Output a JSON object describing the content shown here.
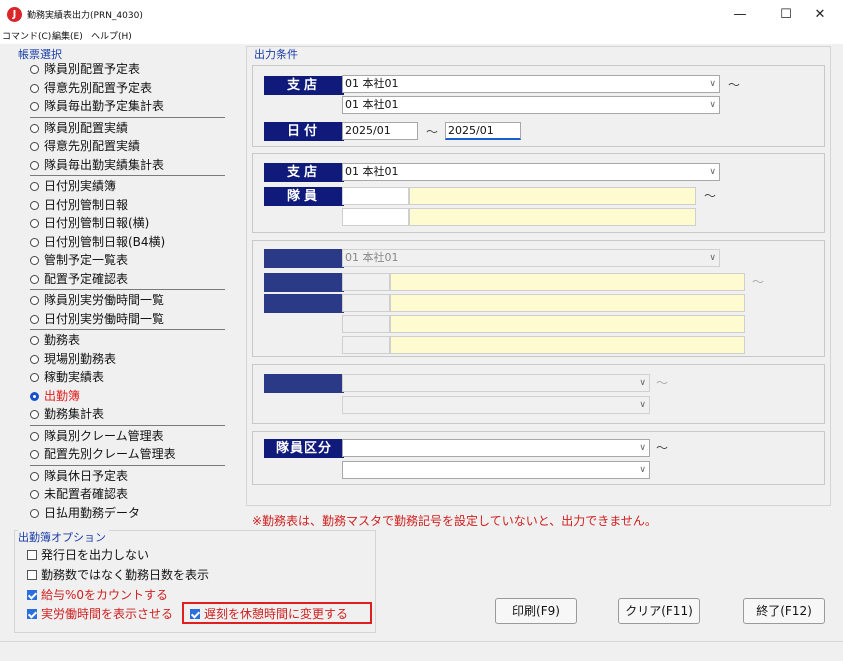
{
  "window": {
    "title": "勤務実績表出力(PRN_4030)",
    "icon_letter": "J",
    "minimize": "—",
    "maximize": "☐",
    "close": "✕"
  },
  "menu": [
    "コマンド(C)",
    "編集(E)",
    "ヘルプ(H)"
  ],
  "report_select": {
    "label": "帳票選択",
    "groups": [
      [
        "隊員別配置予定表",
        "得意先別配置予定表",
        "隊員毎出勤予定集計表"
      ],
      [
        "隊員別配置実績",
        "得意先別配置実績",
        "隊員毎出勤実績集計表"
      ],
      [
        "日付別実績簿",
        "日付別管制日報",
        "日付別管制日報(横)",
        "日付別管制日報(B4横)",
        "管制予定一覧表",
        "配置予定確認表"
      ],
      [
        "隊員別実労働時間一覧",
        "日付別実労働時間一覧"
      ],
      [
        "勤務表",
        "現場別勤務表",
        "稼動実績表",
        "出勤簿",
        "勤務集計表"
      ],
      [
        "隊員別クレーム管理表",
        "配置先別クレーム管理表"
      ],
      [
        "隊員休日予定表",
        "未配置者確認表",
        "日払用勤務データ"
      ]
    ],
    "selected": "出勤簿"
  },
  "conditions": {
    "label": "出力条件",
    "branch_range": {
      "label": "支店",
      "from": "01 本社01",
      "to": "01 本社01",
      "tilde": "～"
    },
    "date_range": {
      "label": "日付",
      "from": "2025/01",
      "to": "2025/01",
      "tilde": "～"
    },
    "branch2": {
      "label": "支店",
      "value": "01 本社01"
    },
    "member": {
      "label": "隊員",
      "tilde": "～"
    },
    "branch3": {
      "label": "支店",
      "value": "01 本社01"
    },
    "tilde3": "～",
    "tilde4": "～",
    "member_class": {
      "label": "隊員区分",
      "tilde": "～"
    },
    "note": "※勤務表は、勤務マスタで勤務記号を設定していないと、出力できません。"
  },
  "options": {
    "label": "出勤簿オプション",
    "items": [
      {
        "label": "発行日を出力しない",
        "checked": false
      },
      {
        "label": "勤務数ではなく勤務日数を表示",
        "checked": false
      },
      {
        "label": "給与%0をカウントする",
        "checked": true
      },
      {
        "label": "実労働時間を表示させる",
        "checked": true
      },
      {
        "label": "遅刻を休憩時間に変更する",
        "checked": true
      }
    ]
  },
  "buttons": {
    "print": "印刷(F9)",
    "clear": "クリア(F11)",
    "exit": "終了(F12)"
  },
  "colors": {
    "label_bg": "#0f1a7a",
    "selected_text": "#e02020",
    "highlight_border": "#e02020",
    "yellow_field": "#fffbd0"
  }
}
